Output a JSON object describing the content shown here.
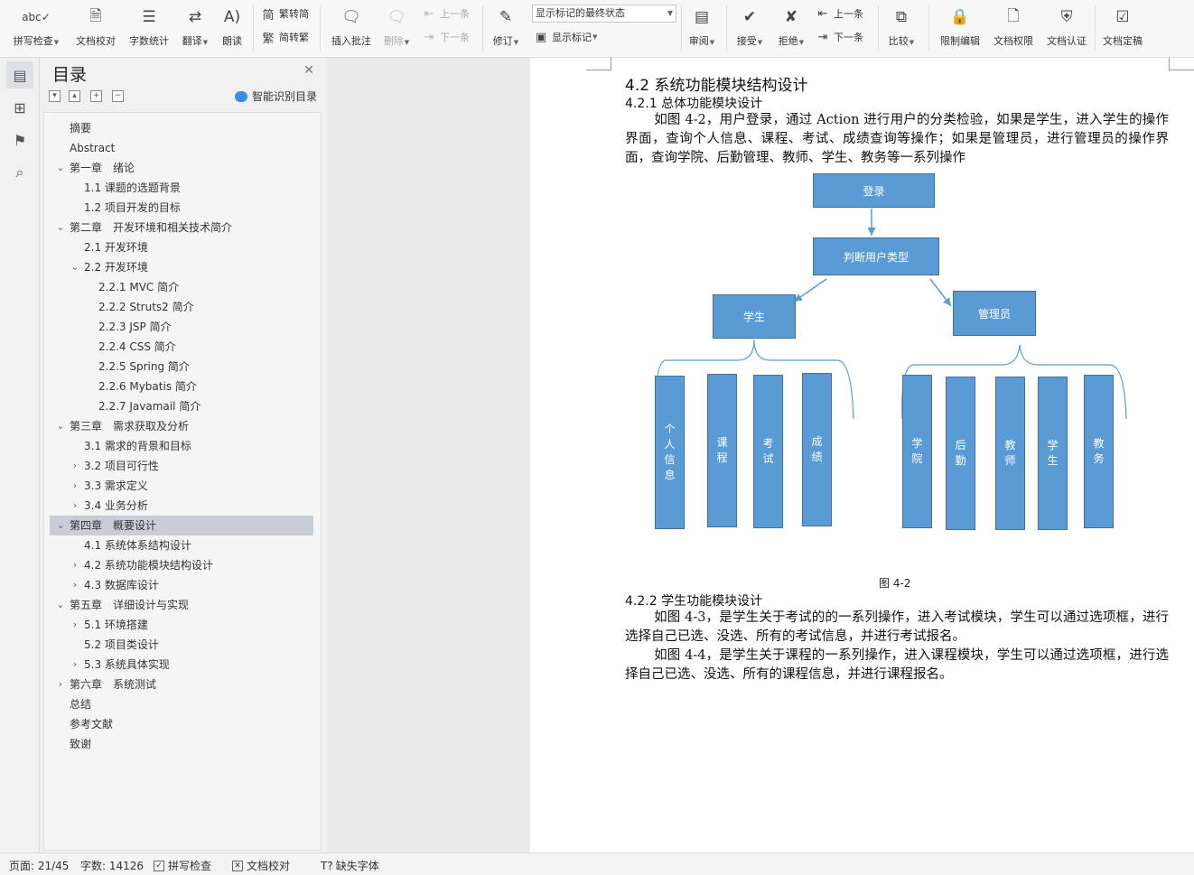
{
  "ribbon": {
    "spell_check": "拼写检查",
    "doc_proofread": "文档校对",
    "word_count": "字数统计",
    "translate": "翻译",
    "read_aloud": "朗读",
    "trad_simp": "繁转简",
    "simp_trad": "简转繁",
    "insert_comment": "插入批注",
    "delete": "删除",
    "prev_comment": "上一条",
    "next_comment": "下一条",
    "revise": "修订",
    "markup_mode": "显示标记的最终状态",
    "show_markup": "显示标记",
    "review": "审阅",
    "accept": "接受",
    "reject": "拒绝",
    "prev_change": "上一条",
    "next_change": "下一条",
    "compare": "比较",
    "restrict_edit": "限制编辑",
    "doc_permission": "文档权限",
    "doc_cert": "文档认证",
    "doc_finalize": "文档定稿"
  },
  "toc": {
    "title": "目录",
    "smart_label": "智能识别目录",
    "items": [
      {
        "text": "摘要",
        "level": 0,
        "arrow": ""
      },
      {
        "text": "Abstract",
        "level": 0,
        "arrow": ""
      },
      {
        "text": "第一章　绪论",
        "level": 0,
        "arrow": "v"
      },
      {
        "text": "1.1  课题的选题背景",
        "level": 1,
        "arrow": ""
      },
      {
        "text": "1.2  项目开发的目标",
        "level": 1,
        "arrow": ""
      },
      {
        "text": "第二章　开发环境和相关技术简介",
        "level": 0,
        "arrow": "v"
      },
      {
        "text": "2.1  开发环境",
        "level": 1,
        "arrow": ""
      },
      {
        "text": "2.2  开发环境",
        "level": 1,
        "arrow": "v"
      },
      {
        "text": "2.2.1 MVC 简介",
        "level": 2,
        "arrow": ""
      },
      {
        "text": "2.2.2 Struts2 简介",
        "level": 2,
        "arrow": ""
      },
      {
        "text": "2.2.3 JSP 简介",
        "level": 2,
        "arrow": ""
      },
      {
        "text": "2.2.4 CSS 简介",
        "level": 2,
        "arrow": ""
      },
      {
        "text": "2.2.5 Spring 简介",
        "level": 2,
        "arrow": ""
      },
      {
        "text": "2.2.6 Mybatis 简介",
        "level": 2,
        "arrow": ""
      },
      {
        "text": "2.2.7 Javamail 简介",
        "level": 2,
        "arrow": ""
      },
      {
        "text": "第三章　需求获取及分析",
        "level": 0,
        "arrow": "v"
      },
      {
        "text": "3.1  需求的背景和目标",
        "level": 1,
        "arrow": ""
      },
      {
        "text": "3.2  项目可行性",
        "level": 1,
        "arrow": ">"
      },
      {
        "text": "3.3  需求定义",
        "level": 1,
        "arrow": ">"
      },
      {
        "text": "3.4  业务分析",
        "level": 1,
        "arrow": ">"
      },
      {
        "text": "第四章　概要设计",
        "level": 0,
        "arrow": "v",
        "selected": true
      },
      {
        "text": "4.1  系统体系结构设计",
        "level": 1,
        "arrow": ""
      },
      {
        "text": "4.2  系统功能模块结构设计",
        "level": 1,
        "arrow": ">"
      },
      {
        "text": "4.3  数据库设计",
        "level": 1,
        "arrow": ">"
      },
      {
        "text": "第五章　详细设计与实现",
        "level": 0,
        "arrow": "v"
      },
      {
        "text": "5.1  环境搭建",
        "level": 1,
        "arrow": ">"
      },
      {
        "text": "5.2  项目类设计",
        "level": 1,
        "arrow": ""
      },
      {
        "text": "5.3  系统具体实现",
        "level": 1,
        "arrow": ">"
      },
      {
        "text": "第六章　系统测试",
        "level": 0,
        "arrow": ">"
      },
      {
        "text": "总结",
        "level": 0,
        "arrow": ""
      },
      {
        "text": "参考文献",
        "level": 0,
        "arrow": ""
      },
      {
        "text": "致谢",
        "level": 0,
        "arrow": ""
      }
    ]
  },
  "document": {
    "heading_4_2": "4.2 系统功能模块结构设计",
    "heading_4_2_1": "4.2.1 总体功能模块设计",
    "para_1": "如图 4-2，用户登录，通过 Action 进行用户的分类检验，如果是学生，进入学生的操作界面，查询个人信息、课程、考试、成绩查询等操作；如果是管理员，进行管理员的操作界面，查询学院、后勤管理、教师、学生、教务等一系列操作",
    "diagram": {
      "login": "登录",
      "judge": "判断用户类型",
      "student": "学生",
      "admin": "管理员",
      "student_modules": [
        "个人信息",
        "课程",
        "考试",
        "成绩"
      ],
      "admin_modules": [
        "学院",
        "后勤",
        "教师",
        "学生",
        "教务"
      ]
    },
    "figure_caption": "图 4-2",
    "heading_4_2_2": "4.2.2 学生功能模块设计",
    "para_2": "如图 4-3，是学生关于考试的的一系列操作，进入考试模块，学生可以通过选项框，进行选择自己已选、没选、所有的考试信息，并进行考试报名。",
    "para_3": "如图 4-4，是学生关于课程的一系列操作，进入课程模块，学生可以通过选项框，进行选择自己已选、没选、所有的课程信息，并进行课程报名。"
  },
  "status": {
    "page": "页面: 21/45",
    "word_count": "字数: 14126",
    "spell_check": "拼写检查",
    "doc_proofread": "文档校对",
    "missing_font": "缺失字体"
  }
}
